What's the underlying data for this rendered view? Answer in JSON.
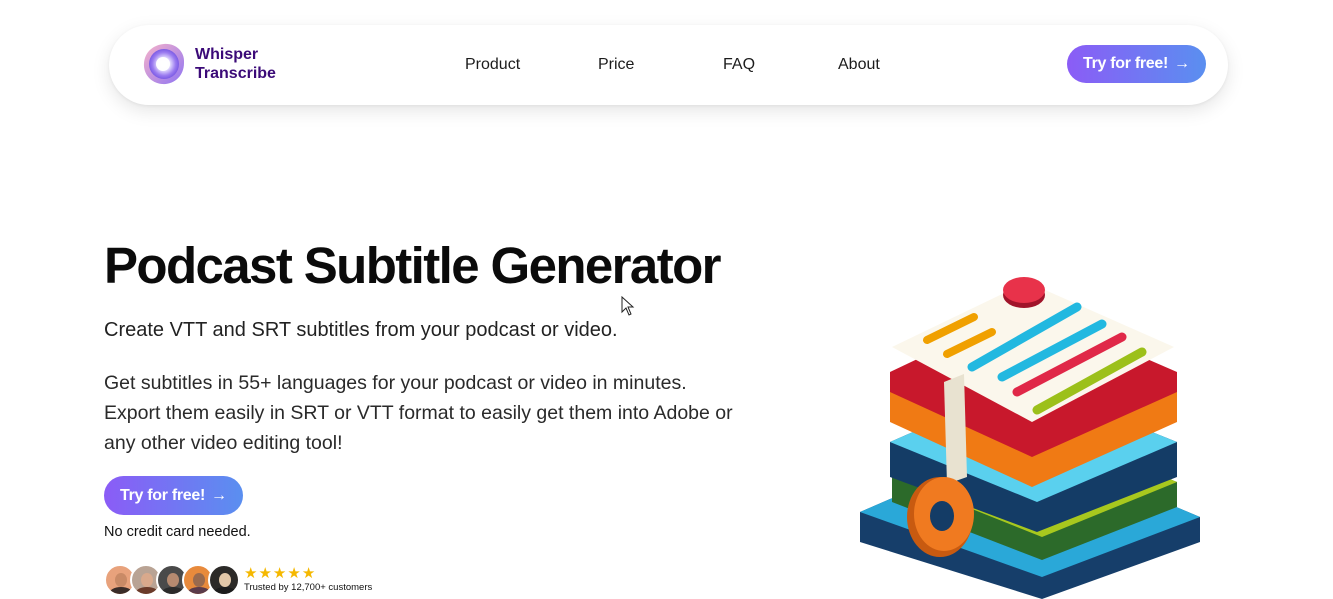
{
  "brand": {
    "line1": "Whisper",
    "line2": "Transcribe",
    "color": "#3b0a78"
  },
  "nav": {
    "links": [
      {
        "label": "Product"
      },
      {
        "label": "Price"
      },
      {
        "label": "FAQ"
      },
      {
        "label": "About"
      }
    ],
    "cta": {
      "label": "Try for free!",
      "icon": "arrow-right-icon",
      "arrow": "→"
    }
  },
  "hero": {
    "title": "Podcast Subtitle Generator",
    "subtitle": "Create VTT and SRT subtitles from your podcast or video.",
    "description": "Get subtitles in 55+ languages for your podcast or video in minutes. Export them easily in SRT or VTT format to easily get them into Adobe or any other video editing tool!",
    "cta": {
      "label": "Try for free!",
      "arrow": "→"
    },
    "note": "No credit card needed."
  },
  "social_proof": {
    "avatar_count": 5,
    "rating_stars": 5,
    "star_glyph": "★",
    "text": "Trusted by 12,700+ customers"
  },
  "colors": {
    "cta_gradient_start": "#8b5cf6",
    "cta_gradient_end": "#5a8ff0",
    "star": "#f5b800"
  }
}
